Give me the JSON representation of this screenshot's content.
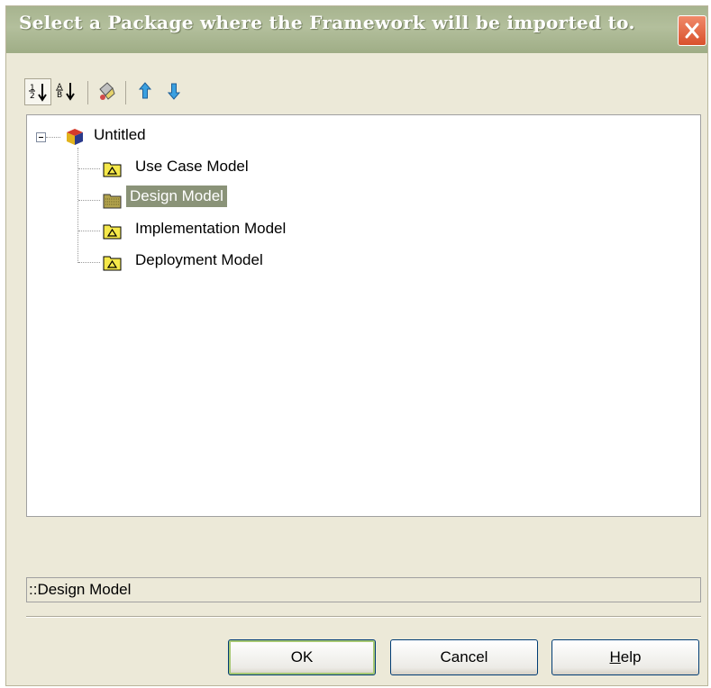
{
  "dialog": {
    "title": "Select a Package where the Framework will be imported to.",
    "close_icon": "close-x-icon"
  },
  "toolbar": {
    "buttons": [
      {
        "name": "sort-numeric-icon"
      },
      {
        "name": "sort-alpha-icon"
      },
      {
        "name": "properties-icon"
      },
      {
        "name": "move-up-arrow-icon"
      },
      {
        "name": "move-down-arrow-icon"
      }
    ]
  },
  "tree": {
    "root": {
      "label": "Untitled",
      "icon": "model-cube-icon",
      "expanded": true
    },
    "children": [
      {
        "label": "Use Case Model",
        "icon": "package-folder-icon"
      },
      {
        "label": "Design Model",
        "icon": "package-folder-icon",
        "selected": true
      },
      {
        "label": "Implementation Model",
        "icon": "package-folder-icon"
      },
      {
        "label": "Deployment Model",
        "icon": "package-folder-icon"
      }
    ]
  },
  "status": {
    "path": "::Design Model"
  },
  "buttons": {
    "ok": "OK",
    "cancel": "Cancel",
    "help": "Help"
  },
  "colors": {
    "title_bar": "#a7b48f",
    "selection": "#8a9378",
    "close": "#e0603a",
    "dialog_bg": "#ece9d8"
  }
}
